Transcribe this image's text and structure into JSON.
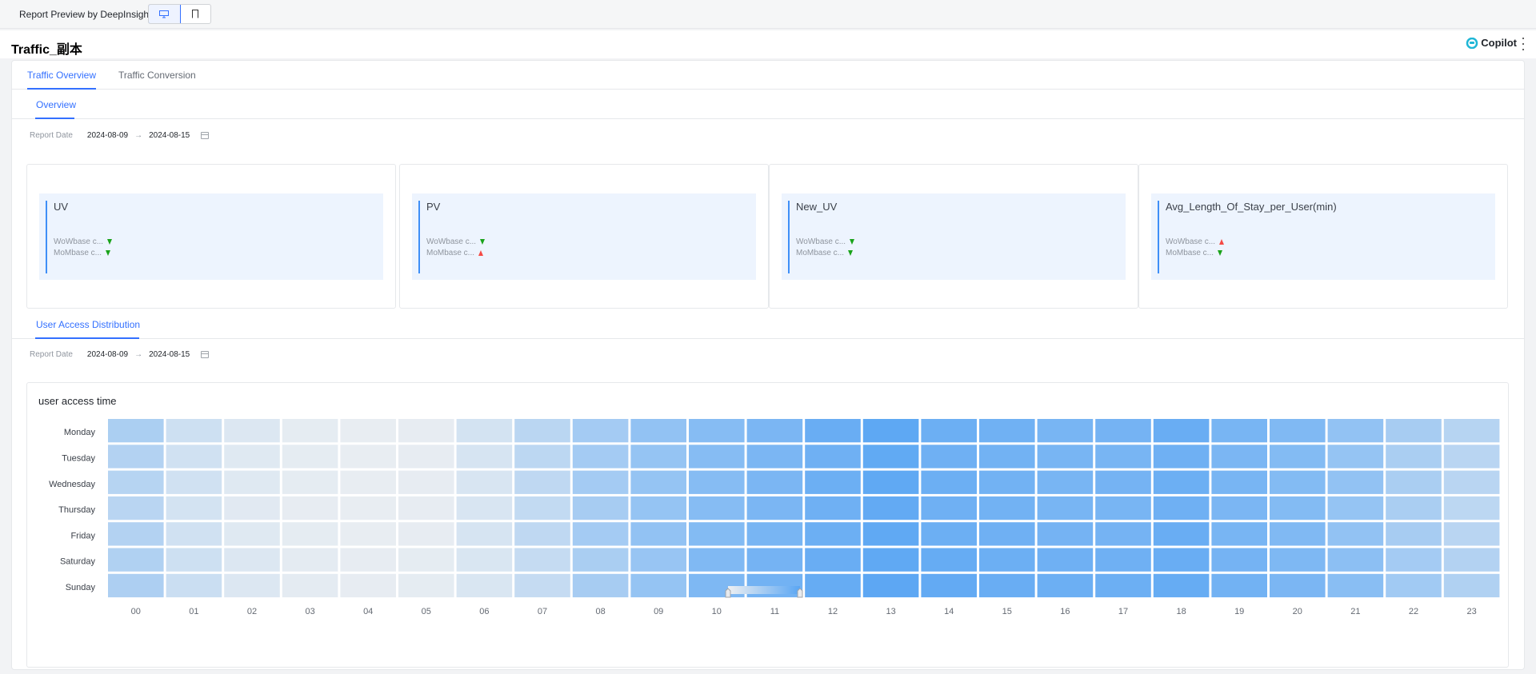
{
  "topbar": {
    "title": "Report Preview by DeepInsight"
  },
  "page": {
    "title": "Traffic_副本",
    "copilot_label": "Copilot"
  },
  "tabs": [
    {
      "label": "Traffic Overview",
      "active": true
    },
    {
      "label": "Traffic Conversion",
      "active": false
    }
  ],
  "overview": {
    "section_label": "Overview",
    "report_date_label": "Report Date",
    "date_start": "2024-08-09",
    "date_end": "2024-08-15",
    "kpis": [
      {
        "name": "UV",
        "wow_label": "WoWbase c...",
        "wow_trend": "down",
        "mom_label": "MoMbase c...",
        "mom_trend": "down"
      },
      {
        "name": "PV",
        "wow_label": "WoWbase c...",
        "wow_trend": "down",
        "mom_label": "MoMbase c...",
        "mom_trend": "up"
      },
      {
        "name": "New_UV",
        "wow_label": "WoWbase c...",
        "wow_trend": "down",
        "mom_label": "MoMbase c...",
        "mom_trend": "down"
      },
      {
        "name": "Avg_Length_Of_Stay_per_User(min)",
        "wow_label": "WoWbase c...",
        "wow_trend": "up",
        "mom_label": "MoMbase c...",
        "mom_trend": "down"
      }
    ]
  },
  "distribution": {
    "section_label": "User Access Distribution",
    "report_date_label": "Report Date",
    "date_start": "2024-08-09",
    "date_end": "2024-08-15"
  },
  "colors": {
    "accent": "#3370ff",
    "heat_low": "#eef0f2",
    "heat_high": "#5aa6f3",
    "up": "#f54a45",
    "down": "#1aa31a"
  },
  "chart_data": {
    "type": "heatmap",
    "title": "user access time",
    "x_categories": [
      "00",
      "01",
      "02",
      "03",
      "04",
      "05",
      "06",
      "07",
      "08",
      "09",
      "10",
      "11",
      "12",
      "13",
      "14",
      "15",
      "16",
      "17",
      "18",
      "19",
      "20",
      "21",
      "22",
      "23"
    ],
    "y_categories": [
      "Monday",
      "Tuesday",
      "Wednesday",
      "Thursday",
      "Friday",
      "Saturday",
      "Sunday"
    ],
    "value_range": [
      0,
      1
    ],
    "values": [
      [
        0.45,
        0.22,
        0.12,
        0.06,
        0.04,
        0.05,
        0.18,
        0.35,
        0.5,
        0.62,
        0.7,
        0.78,
        0.9,
        0.97,
        0.88,
        0.85,
        0.8,
        0.82,
        0.9,
        0.8,
        0.74,
        0.62,
        0.48,
        0.38
      ],
      [
        0.4,
        0.2,
        0.1,
        0.06,
        0.04,
        0.05,
        0.16,
        0.34,
        0.5,
        0.6,
        0.7,
        0.78,
        0.86,
        0.95,
        0.86,
        0.84,
        0.8,
        0.8,
        0.86,
        0.78,
        0.72,
        0.6,
        0.46,
        0.36
      ],
      [
        0.38,
        0.2,
        0.1,
        0.06,
        0.04,
        0.05,
        0.15,
        0.32,
        0.5,
        0.6,
        0.7,
        0.78,
        0.88,
        0.96,
        0.88,
        0.84,
        0.8,
        0.82,
        0.88,
        0.8,
        0.72,
        0.62,
        0.46,
        0.36
      ],
      [
        0.36,
        0.18,
        0.09,
        0.05,
        0.04,
        0.05,
        0.15,
        0.3,
        0.48,
        0.6,
        0.7,
        0.78,
        0.86,
        0.94,
        0.86,
        0.84,
        0.8,
        0.8,
        0.86,
        0.78,
        0.72,
        0.6,
        0.46,
        0.34
      ],
      [
        0.4,
        0.2,
        0.1,
        0.06,
        0.04,
        0.05,
        0.16,
        0.32,
        0.5,
        0.62,
        0.72,
        0.8,
        0.88,
        0.96,
        0.88,
        0.86,
        0.82,
        0.82,
        0.9,
        0.8,
        0.74,
        0.62,
        0.48,
        0.36
      ],
      [
        0.42,
        0.22,
        0.12,
        0.07,
        0.05,
        0.06,
        0.14,
        0.28,
        0.46,
        0.58,
        0.74,
        0.82,
        0.9,
        0.96,
        0.92,
        0.88,
        0.86,
        0.86,
        0.9,
        0.82,
        0.76,
        0.66,
        0.5,
        0.4
      ],
      [
        0.44,
        0.24,
        0.12,
        0.07,
        0.05,
        0.06,
        0.14,
        0.28,
        0.48,
        0.6,
        0.76,
        0.84,
        0.92,
        0.98,
        0.94,
        0.9,
        0.88,
        0.88,
        0.92,
        0.84,
        0.78,
        0.68,
        0.52,
        0.42
      ]
    ],
    "legend": "bottom-center"
  }
}
